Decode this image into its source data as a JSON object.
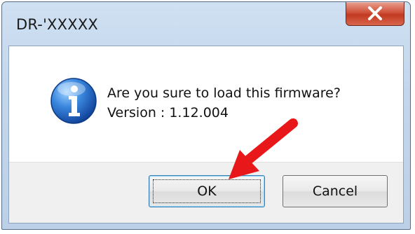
{
  "window": {
    "title": "DR-'XXXXX"
  },
  "dialog": {
    "message": "Are you sure to load this firmware?",
    "version_line": "Version : 1.12.004"
  },
  "buttons": {
    "ok_label": "OK",
    "cancel_label": "Cancel"
  },
  "icons": {
    "close": "close-icon",
    "info": "information-icon",
    "annotation": "red-arrow-annotation"
  },
  "colors": {
    "close_button": "#c94a30",
    "annotation_arrow": "#e8171a",
    "info_icon": "#1e5fc0"
  }
}
